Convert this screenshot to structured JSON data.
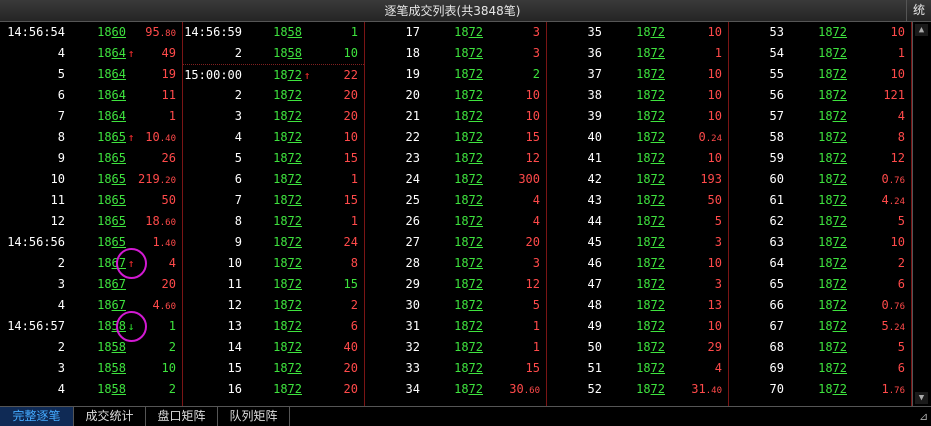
{
  "window": {
    "title": "逐笔成交列表(共3848笔)",
    "corner_button": "统"
  },
  "tabs": [
    {
      "label": "完整逐笔",
      "active": true
    },
    {
      "label": "成交统计",
      "active": false
    },
    {
      "label": "盘口矩阵",
      "active": false
    },
    {
      "label": "队列矩阵",
      "active": false
    }
  ],
  "colors": {
    "up": "#ff4a4a",
    "down": "#3ee33e",
    "separator": "#7a1515",
    "highlight_circle": "#d21ad2"
  },
  "columns": [
    [
      {
        "t": "14:56:54",
        "p": [
          "18",
          "60"
        ],
        "v": "95",
        "vd": ".80"
      },
      {
        "t": "4",
        "p": [
          "18",
          "64"
        ],
        "a": "up",
        "v": "49"
      },
      {
        "t": "5",
        "p": [
          "18",
          "64"
        ],
        "v": "19"
      },
      {
        "t": "6",
        "p": [
          "18",
          "64"
        ],
        "v": "11"
      },
      {
        "t": "7",
        "p": [
          "18",
          "64"
        ],
        "v": "1"
      },
      {
        "t": "8",
        "p": [
          "18",
          "65"
        ],
        "a": "up",
        "v": "10",
        "vd": ".40"
      },
      {
        "t": "9",
        "p": [
          "18",
          "65"
        ],
        "v": "26"
      },
      {
        "t": "10",
        "p": [
          "18",
          "65"
        ],
        "v": "219",
        "vd": ".20"
      },
      {
        "t": "11",
        "p": [
          "18",
          "65"
        ],
        "v": "50"
      },
      {
        "t": "12",
        "p": [
          "18",
          "65"
        ],
        "v": "18",
        "vd": ".60"
      },
      {
        "t": "14:56:56",
        "p": [
          "18",
          "65"
        ],
        "v": "1",
        "vd": ".40"
      },
      {
        "t": "2",
        "p": [
          "18",
          "67"
        ],
        "a": "up",
        "v": "4",
        "circle": true
      },
      {
        "t": "3",
        "p": [
          "18",
          "67"
        ],
        "v": "20"
      },
      {
        "t": "4",
        "p": [
          "18",
          "67"
        ],
        "v": "4",
        "vd": ".60"
      },
      {
        "t": "14:56:57",
        "p": [
          "18",
          "58"
        ],
        "a": "dn",
        "v": "1",
        "vc": "dn",
        "circle": true
      },
      {
        "t": "2",
        "p": [
          "18",
          "58"
        ],
        "v": "2",
        "vc": "dn"
      },
      {
        "t": "3",
        "p": [
          "18",
          "58"
        ],
        "v": "10",
        "vc": "dn"
      },
      {
        "t": "4",
        "p": [
          "18",
          "58"
        ],
        "v": "2",
        "vc": "dn"
      }
    ],
    [
      {
        "t": "14:56:59",
        "p": [
          "18",
          "58"
        ],
        "v": "1",
        "vc": "dn"
      },
      {
        "t": "2",
        "p": [
          "18",
          "58"
        ],
        "v": "10",
        "vc": "dn"
      },
      {
        "t": "15:00:00",
        "p": [
          "18",
          "72"
        ],
        "a": "up",
        "v": "22",
        "sep": true
      },
      {
        "t": "2",
        "p": [
          "18",
          "72"
        ],
        "v": "20"
      },
      {
        "t": "3",
        "p": [
          "18",
          "72"
        ],
        "v": "20"
      },
      {
        "t": "4",
        "p": [
          "18",
          "72"
        ],
        "v": "10"
      },
      {
        "t": "5",
        "p": [
          "18",
          "72"
        ],
        "v": "15"
      },
      {
        "t": "6",
        "p": [
          "18",
          "72"
        ],
        "v": "1"
      },
      {
        "t": "7",
        "p": [
          "18",
          "72"
        ],
        "v": "15"
      },
      {
        "t": "8",
        "p": [
          "18",
          "72"
        ],
        "v": "1"
      },
      {
        "t": "9",
        "p": [
          "18",
          "72"
        ],
        "v": "24"
      },
      {
        "t": "10",
        "p": [
          "18",
          "72"
        ],
        "v": "8"
      },
      {
        "t": "11",
        "p": [
          "18",
          "72"
        ],
        "v": "15",
        "vc": "dn"
      },
      {
        "t": "12",
        "p": [
          "18",
          "72"
        ],
        "v": "2"
      },
      {
        "t": "13",
        "p": [
          "18",
          "72"
        ],
        "v": "6"
      },
      {
        "t": "14",
        "p": [
          "18",
          "72"
        ],
        "v": "40"
      },
      {
        "t": "15",
        "p": [
          "18",
          "72"
        ],
        "v": "20"
      },
      {
        "t": "16",
        "p": [
          "18",
          "72"
        ],
        "v": "20"
      }
    ],
    [
      {
        "t": "17",
        "p": [
          "18",
          "72"
        ],
        "v": "3"
      },
      {
        "t": "18",
        "p": [
          "18",
          "72"
        ],
        "v": "3"
      },
      {
        "t": "19",
        "p": [
          "18",
          "72"
        ],
        "v": "2",
        "vc": "dn"
      },
      {
        "t": "20",
        "p": [
          "18",
          "72"
        ],
        "v": "10"
      },
      {
        "t": "21",
        "p": [
          "18",
          "72"
        ],
        "v": "10"
      },
      {
        "t": "22",
        "p": [
          "18",
          "72"
        ],
        "v": "15"
      },
      {
        "t": "23",
        "p": [
          "18",
          "72"
        ],
        "v": "12"
      },
      {
        "t": "24",
        "p": [
          "18",
          "72"
        ],
        "v": "300"
      },
      {
        "t": "25",
        "p": [
          "18",
          "72"
        ],
        "v": "4"
      },
      {
        "t": "26",
        "p": [
          "18",
          "72"
        ],
        "v": "4"
      },
      {
        "t": "27",
        "p": [
          "18",
          "72"
        ],
        "v": "20"
      },
      {
        "t": "28",
        "p": [
          "18",
          "72"
        ],
        "v": "3"
      },
      {
        "t": "29",
        "p": [
          "18",
          "72"
        ],
        "v": "12"
      },
      {
        "t": "30",
        "p": [
          "18",
          "72"
        ],
        "v": "5"
      },
      {
        "t": "31",
        "p": [
          "18",
          "72"
        ],
        "v": "1"
      },
      {
        "t": "32",
        "p": [
          "18",
          "72"
        ],
        "v": "1"
      },
      {
        "t": "33",
        "p": [
          "18",
          "72"
        ],
        "v": "15"
      },
      {
        "t": "34",
        "p": [
          "18",
          "72"
        ],
        "v": "30",
        "vd": ".60"
      }
    ],
    [
      {
        "t": "35",
        "p": [
          "18",
          "72"
        ],
        "v": "10"
      },
      {
        "t": "36",
        "p": [
          "18",
          "72"
        ],
        "v": "1"
      },
      {
        "t": "37",
        "p": [
          "18",
          "72"
        ],
        "v": "10"
      },
      {
        "t": "38",
        "p": [
          "18",
          "72"
        ],
        "v": "10"
      },
      {
        "t": "39",
        "p": [
          "18",
          "72"
        ],
        "v": "10"
      },
      {
        "t": "40",
        "p": [
          "18",
          "72"
        ],
        "v": "0",
        "vd": ".24"
      },
      {
        "t": "41",
        "p": [
          "18",
          "72"
        ],
        "v": "10"
      },
      {
        "t": "42",
        "p": [
          "18",
          "72"
        ],
        "v": "193"
      },
      {
        "t": "43",
        "p": [
          "18",
          "72"
        ],
        "v": "50"
      },
      {
        "t": "44",
        "p": [
          "18",
          "72"
        ],
        "v": "5"
      },
      {
        "t": "45",
        "p": [
          "18",
          "72"
        ],
        "v": "3"
      },
      {
        "t": "46",
        "p": [
          "18",
          "72"
        ],
        "v": "10"
      },
      {
        "t": "47",
        "p": [
          "18",
          "72"
        ],
        "v": "3"
      },
      {
        "t": "48",
        "p": [
          "18",
          "72"
        ],
        "v": "13"
      },
      {
        "t": "49",
        "p": [
          "18",
          "72"
        ],
        "v": "10"
      },
      {
        "t": "50",
        "p": [
          "18",
          "72"
        ],
        "v": "29"
      },
      {
        "t": "51",
        "p": [
          "18",
          "72"
        ],
        "v": "4"
      },
      {
        "t": "52",
        "p": [
          "18",
          "72"
        ],
        "v": "31",
        "vd": ".40"
      }
    ],
    [
      {
        "t": "53",
        "p": [
          "18",
          "72"
        ],
        "v": "10"
      },
      {
        "t": "54",
        "p": [
          "18",
          "72"
        ],
        "v": "1"
      },
      {
        "t": "55",
        "p": [
          "18",
          "72"
        ],
        "v": "10"
      },
      {
        "t": "56",
        "p": [
          "18",
          "72"
        ],
        "v": "121"
      },
      {
        "t": "57",
        "p": [
          "18",
          "72"
        ],
        "v": "4"
      },
      {
        "t": "58",
        "p": [
          "18",
          "72"
        ],
        "v": "8"
      },
      {
        "t": "59",
        "p": [
          "18",
          "72"
        ],
        "v": "12"
      },
      {
        "t": "60",
        "p": [
          "18",
          "72"
        ],
        "v": "0",
        "vd": ".76"
      },
      {
        "t": "61",
        "p": [
          "18",
          "72"
        ],
        "v": "4",
        "vd": ".24"
      },
      {
        "t": "62",
        "p": [
          "18",
          "72"
        ],
        "v": "5"
      },
      {
        "t": "63",
        "p": [
          "18",
          "72"
        ],
        "v": "10"
      },
      {
        "t": "64",
        "p": [
          "18",
          "72"
        ],
        "v": "2"
      },
      {
        "t": "65",
        "p": [
          "18",
          "72"
        ],
        "v": "6"
      },
      {
        "t": "66",
        "p": [
          "18",
          "72"
        ],
        "v": "0",
        "vd": ".76"
      },
      {
        "t": "67",
        "p": [
          "18",
          "72"
        ],
        "v": "5",
        "vd": ".24"
      },
      {
        "t": "68",
        "p": [
          "18",
          "72"
        ],
        "v": "5"
      },
      {
        "t": "69",
        "p": [
          "18",
          "72"
        ],
        "v": "6"
      },
      {
        "t": "70",
        "p": [
          "18",
          "72"
        ],
        "v": "1",
        "vd": ".76"
      }
    ]
  ]
}
